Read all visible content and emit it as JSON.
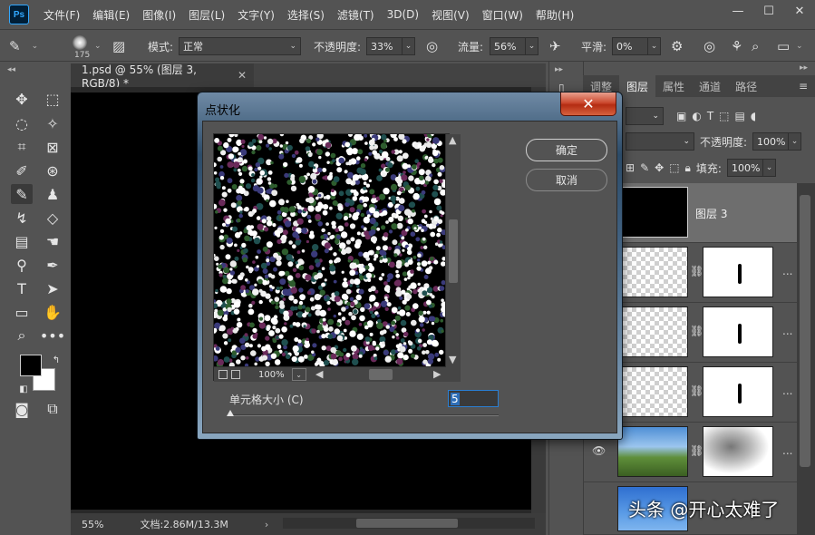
{
  "app": {
    "logo": "Ps"
  },
  "menu": [
    "文件(F)",
    "编辑(E)",
    "图像(I)",
    "图层(L)",
    "文字(Y)",
    "选择(S)",
    "滤镜(T)",
    "3D(D)",
    "视图(V)",
    "窗口(W)",
    "帮助(H)"
  ],
  "window_controls": {
    "minimize": "—",
    "maximize": "☐",
    "close": "✕"
  },
  "options": {
    "brush_size": "175",
    "mode_label": "模式:",
    "mode_value": "正常",
    "opacity_label": "不透明度:",
    "opacity_value": "33%",
    "flow_label": "流量:",
    "flow_value": "56%",
    "smooth_label": "平滑:",
    "smooth_value": "0%"
  },
  "document": {
    "tab_title": "1.psd @ 55% (图层 3, RGB/8) *",
    "tab_close": "✕",
    "zoom": "55%",
    "doc_size": "文档:2.86M/13.3M"
  },
  "layers_panel": {
    "tabs": [
      "调整",
      "图层",
      "属性",
      "通道",
      "路径"
    ],
    "active_tab": "图层",
    "opacity_label": "不透明度:",
    "opacity_value": "100%",
    "fill_label": "填充:",
    "fill_value": "100%",
    "selected_layer_name": "图层 3",
    "more": "..."
  },
  "dialog": {
    "title": "点状化",
    "ok_label": "确定",
    "cancel_label": "取消",
    "zoom_value": "100%",
    "cell_size_label": "单元格大小 (C)",
    "cell_size_value": "5"
  },
  "colors": {
    "foreground": "#000000",
    "background": "#ffffff",
    "ui_gray": "#535353",
    "close_red": "#c8452b"
  },
  "watermark": "头条 @开心太难了"
}
